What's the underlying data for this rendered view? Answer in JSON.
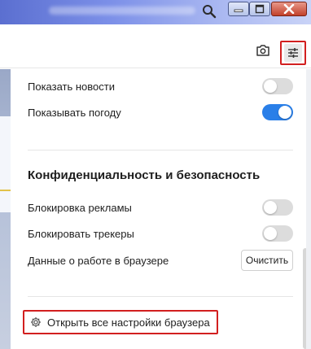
{
  "window": {
    "controls": {
      "minimize_icon": "minimize-icon",
      "maximize_icon": "maximize-icon",
      "close_icon": "close-icon"
    }
  },
  "toolbar": {
    "camera_icon": "camera-icon",
    "settings_icon": "sliders-icon"
  },
  "panel": {
    "rows": [
      {
        "label": "Показать новости",
        "enabled": false
      },
      {
        "label": "Показывать погоду",
        "enabled": true
      }
    ],
    "privacy": {
      "title": "Конфиденциальность и безопасность",
      "rows": [
        {
          "label": "Блокировка рекламы",
          "enabled": false
        },
        {
          "label": "Блокировать трекеры",
          "enabled": false
        }
      ],
      "browser_data_label": "Данные о работе в браузере",
      "clear_button_label": "Очистить"
    },
    "open_all_settings_label": "Открыть все настройки браузера"
  },
  "colors": {
    "accent": "#2a7fe8",
    "highlight": "#d21f1f",
    "toggle_off": "#dcdcdc"
  }
}
